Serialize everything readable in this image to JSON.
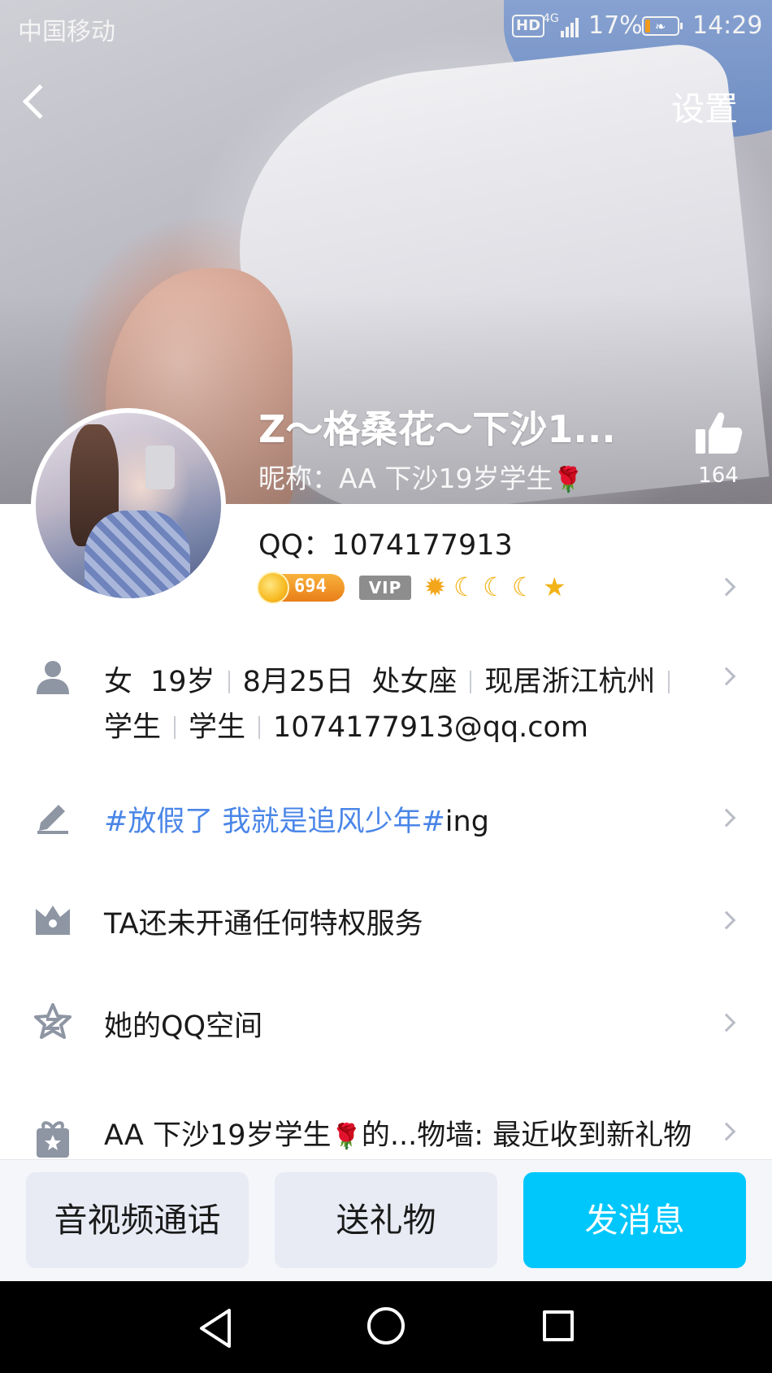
{
  "status_bar": {
    "carrier": "中国移动",
    "hd": "HD",
    "network": "4G",
    "battery_percent": "17%",
    "battery_level": 0.17,
    "time": "14:29"
  },
  "nav": {
    "back_icon": "chevron-left-icon",
    "settings_label": "设置"
  },
  "profile": {
    "name": "Z～格桑花～下沙1...",
    "nickname_prefix": "昵称：AA 下沙19岁学生",
    "nickname_emoji": "🌹",
    "likes": "164",
    "qq_label": "QQ：1074177913",
    "coin_level": "694",
    "vip_label": "VIP",
    "level_icons": [
      "sun-icon",
      "moon-icon",
      "moon-icon",
      "moon-icon",
      "star-icon"
    ]
  },
  "info": {
    "gender": "女",
    "age": "19岁",
    "birthday": "8月25日",
    "zodiac": "处女座",
    "location": "现居浙江杭州",
    "job1": "学生",
    "job2": "学生",
    "email": "1074177913@qq.com"
  },
  "signature": {
    "tag": "#放假了 我就是追风少年#",
    "suffix": "ing"
  },
  "privilege": {
    "text": "TA还未开通任何特权服务"
  },
  "qzone": {
    "text": "她的QQ空间"
  },
  "gift_wall": {
    "prefix": "AA 下沙19岁学生",
    "emoji": "🌹",
    "suffix": "的...物墙: 最近收到新礼物"
  },
  "actions": {
    "call": "音视频通话",
    "gift": "送礼物",
    "message": "发消息"
  },
  "colors": {
    "accent": "#00c7fb",
    "tag_blue": "#4a86e8",
    "vip_grey": "#8d8d8d",
    "coin_orange": "#f29b1d"
  }
}
